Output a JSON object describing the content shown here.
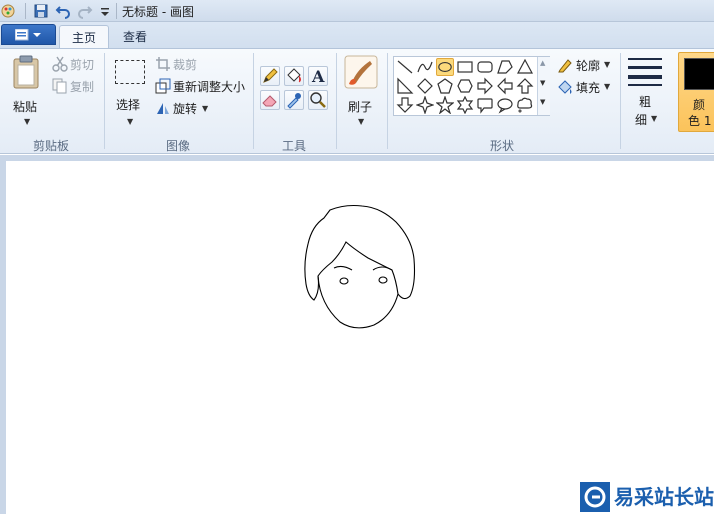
{
  "window": {
    "title": "无标题 - 画图"
  },
  "tabs": [
    {
      "label": "主页",
      "active": true
    },
    {
      "label": "查看",
      "active": false
    }
  ],
  "clipboard": {
    "paste": "粘贴",
    "cut": "剪切",
    "copy": "复制",
    "group": "剪贴板"
  },
  "image": {
    "select": "选择",
    "crop": "裁剪",
    "resize": "重新调整大小",
    "rotate": "旋转",
    "group": "图像"
  },
  "tools": {
    "group": "工具",
    "icons": [
      "pencil-icon",
      "fill-bucket-icon",
      "text-icon",
      "eraser-icon",
      "color-picker-icon",
      "magnifier-icon"
    ]
  },
  "brushes": {
    "label": "刷子"
  },
  "shapes": {
    "group": "形状",
    "outline": "轮廓",
    "fill": "填充",
    "items": [
      "line",
      "curve",
      "oval",
      "rectangle",
      "rounded-rectangle",
      "polygon",
      "triangle",
      "right-triangle",
      "diamond",
      "pentagon",
      "hexagon",
      "right-arrow",
      "left-arrow",
      "up-arrow",
      "down-arrow",
      "four-point-star",
      "five-point-star",
      "six-point-star",
      "rounded-callout",
      "oval-callout",
      "cloud-callout"
    ],
    "selected": "oval"
  },
  "size": {
    "label_line1": "粗",
    "label_line2": "细"
  },
  "color1": {
    "label_line1": "颜",
    "label_line2": "色 1",
    "color": "#000000"
  },
  "colors": {
    "accent": "#1f56a8",
    "selected_shape": "#fbd97c"
  },
  "watermark": {
    "text": "易采站长站"
  }
}
